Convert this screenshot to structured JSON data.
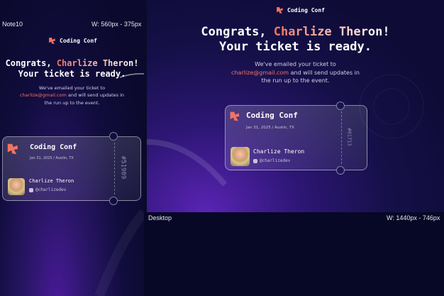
{
  "mobile": {
    "device_label": "Note10",
    "size_label": "W: 560px - 375px",
    "brand": "Coding Conf",
    "headline_line1_pre": "Congrats, ",
    "headline_name": "Charlize Theron",
    "headline_line1_post": "!",
    "headline_line2": "Your ticket is ready.",
    "sub_line1": "We've emailed your ticket to",
    "sub_email": "charlize@gmail.com",
    "sub_line2_post": " and will send updates in",
    "sub_line3": "the run up to the event.",
    "ticket": {
      "event": "Coding Conf",
      "date": "Jan 31, 2025 / Austin, TX",
      "attendee": "Charlize Theron",
      "handle": "@charlizedev",
      "number": "#51989"
    }
  },
  "desktop": {
    "device_label": "Desktop",
    "size_label": "W: 1440px - 746px",
    "brand": "Coding Conf",
    "headline_line1_pre": "Congrats, ",
    "headline_name": "Charlize Theron",
    "headline_line1_post": "!",
    "headline_line2": "Your ticket is ready.",
    "sub_line1": "We've emailed your ticket to",
    "sub_email": "charlize@gmail.com",
    "sub_line2_post": " and will send updates in",
    "sub_line3": "the run up to the event.",
    "ticket": {
      "event": "Coding Conf",
      "date": "Jan 31, 2025 / Austin, TX",
      "attendee": "Charlize Theron",
      "handle": "@charlizedev",
      "number": "#01713"
    }
  },
  "colors": {
    "accent": "#f37362",
    "background": "#0b0a2e",
    "purple": "#5a24b4"
  },
  "icons": [
    "conf-logo-icon",
    "github-icon"
  ]
}
